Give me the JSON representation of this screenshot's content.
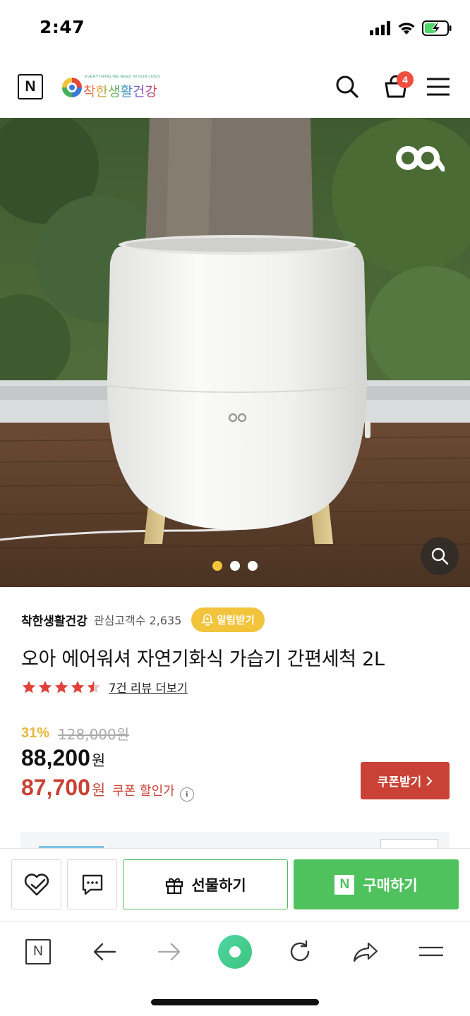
{
  "status_bar": {
    "time": "2:47"
  },
  "header": {
    "n_label": "N",
    "brand_tagline": "EVERYTHING WE NEED IN OUR LIVES",
    "brand_name": "착한생활건강",
    "cart_count": "4"
  },
  "hero": {
    "watermark": "oa",
    "slides": 3,
    "active_slide": 1
  },
  "product": {
    "store_name": "착한생활건강",
    "fans_label": "관심고객수 2,635",
    "alarm_label": "알림받기",
    "title": "오아 에어워셔 자연기화식 가습기 간편세척 2L",
    "rating": 4.5,
    "review_link": "7건 리뷰 더보기",
    "discount_rate": "31%",
    "original_price": "128,000원",
    "sale_price": "88,200",
    "coupon_price": "87,700",
    "currency": "원",
    "coupon_label": "쿠폰 할인가",
    "info_icon": "i",
    "coupon_button": "쿠폰받기"
  },
  "buy_bar": {
    "gift_label": "선물하기",
    "buy_label": "구매하기",
    "buy_n": "N"
  },
  "toolbar": {
    "n_label": "N"
  },
  "colors": {
    "accent_yellow": "#f2c43c",
    "coupon_red": "#c94235",
    "naver_green": "#4fc15d",
    "badge_red": "#f04e3e"
  }
}
